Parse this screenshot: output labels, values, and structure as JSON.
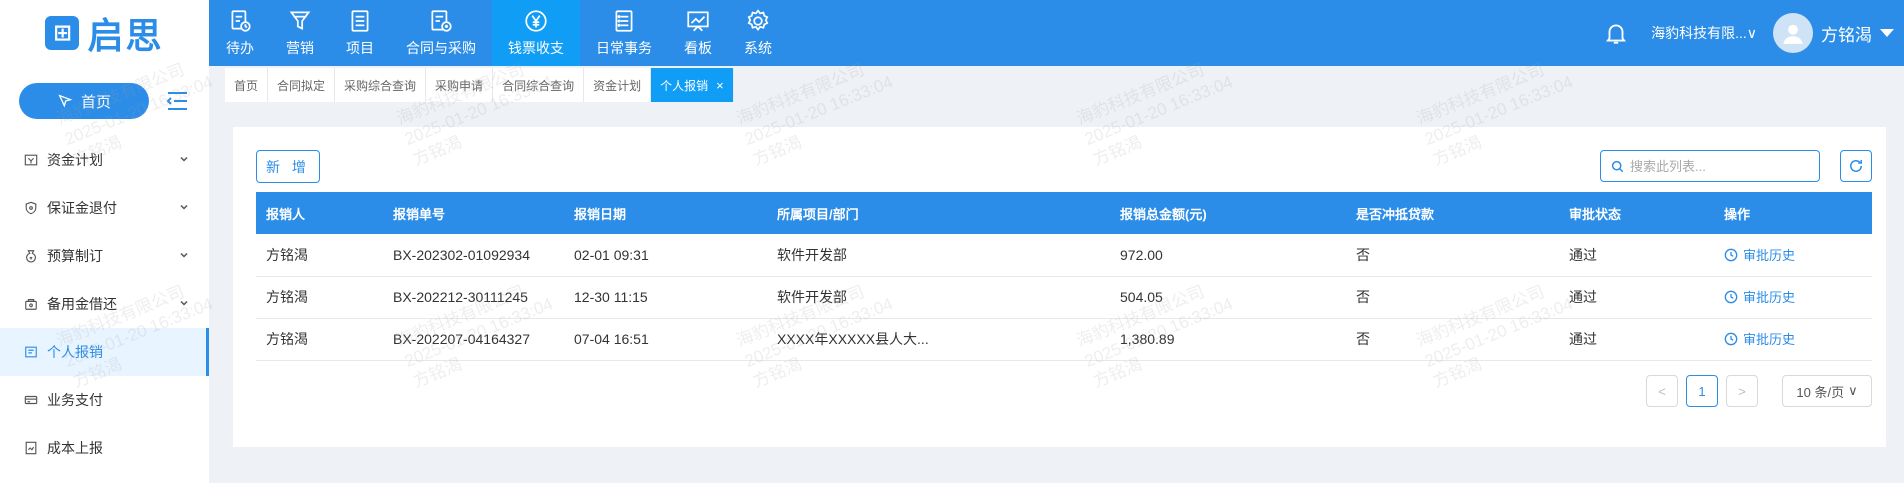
{
  "logo": {
    "text": "启思",
    "mark": "⊞"
  },
  "nav": [
    {
      "label": "待办",
      "icon": "todo-icon"
    },
    {
      "label": "营销",
      "icon": "funnel-icon"
    },
    {
      "label": "项目",
      "icon": "project-icon"
    },
    {
      "label": "合同与采购",
      "icon": "contract-icon"
    },
    {
      "label": "钱票收支",
      "icon": "yuan-icon",
      "active": true
    },
    {
      "label": "日常事务",
      "icon": "list-icon"
    },
    {
      "label": "看板",
      "icon": "board-icon"
    },
    {
      "label": "系统",
      "icon": "gear-icon"
    }
  ],
  "top_right": {
    "company": "海豹科技有限...",
    "company_caret": "∨",
    "username": "方铭渴"
  },
  "sidebar": {
    "home_label": "首页",
    "items": [
      {
        "label": "资金计划",
        "icon": "fund-icon",
        "expandable": true
      },
      {
        "label": "保证金退付",
        "icon": "shield-icon",
        "expandable": true
      },
      {
        "label": "预算制订",
        "icon": "budget-icon",
        "expandable": true
      },
      {
        "label": "备用金借还",
        "icon": "cash-icon",
        "expandable": true
      },
      {
        "label": "个人报销",
        "icon": "reimburse-icon",
        "active": true
      },
      {
        "label": "业务支付",
        "icon": "payment-icon"
      },
      {
        "label": "成本上报",
        "icon": "report-icon"
      }
    ]
  },
  "tabs": [
    {
      "label": "首页"
    },
    {
      "label": "合同拟定"
    },
    {
      "label": "采购综合查询"
    },
    {
      "label": "采购申请"
    },
    {
      "label": "合同综合查询"
    },
    {
      "label": "资金计划"
    },
    {
      "label": "个人报销",
      "active": true,
      "close": "×"
    }
  ],
  "toolbar": {
    "add_label": "新 增",
    "search_placeholder": "搜索此列表..."
  },
  "table": {
    "columns": [
      "报销人",
      "报销单号",
      "报销日期",
      "所属项目/部门",
      "报销总金额(元)",
      "是否冲抵贷款",
      "审批状态",
      "操作"
    ],
    "rows": [
      [
        "方铭渴",
        "BX-202302-01092934",
        "02-01 09:31",
        "软件开发部",
        "972.00",
        "否",
        "通过",
        "审批历史"
      ],
      [
        "方铭渴",
        "BX-202212-30111245",
        "12-30 11:15",
        "软件开发部",
        "504.05",
        "否",
        "通过",
        "审批历史"
      ],
      [
        "方铭渴",
        "BX-202207-04164327",
        "07-04 16:51",
        "XXXX年XXXXX县人大...",
        "1,380.89",
        "否",
        "通过",
        "审批历史"
      ]
    ]
  },
  "pagination": {
    "prev": "<",
    "current": "1",
    "next": ">",
    "page_size": "10 条/页",
    "page_size_caret": "∨"
  },
  "watermark": {
    "line1": "海豹科技有限公司",
    "line2": "2025-01-20 16:33:04",
    "line3": "方铭渴"
  },
  "colors": {
    "primary": "#2b8de8",
    "active_nav": "#0f9df5"
  }
}
